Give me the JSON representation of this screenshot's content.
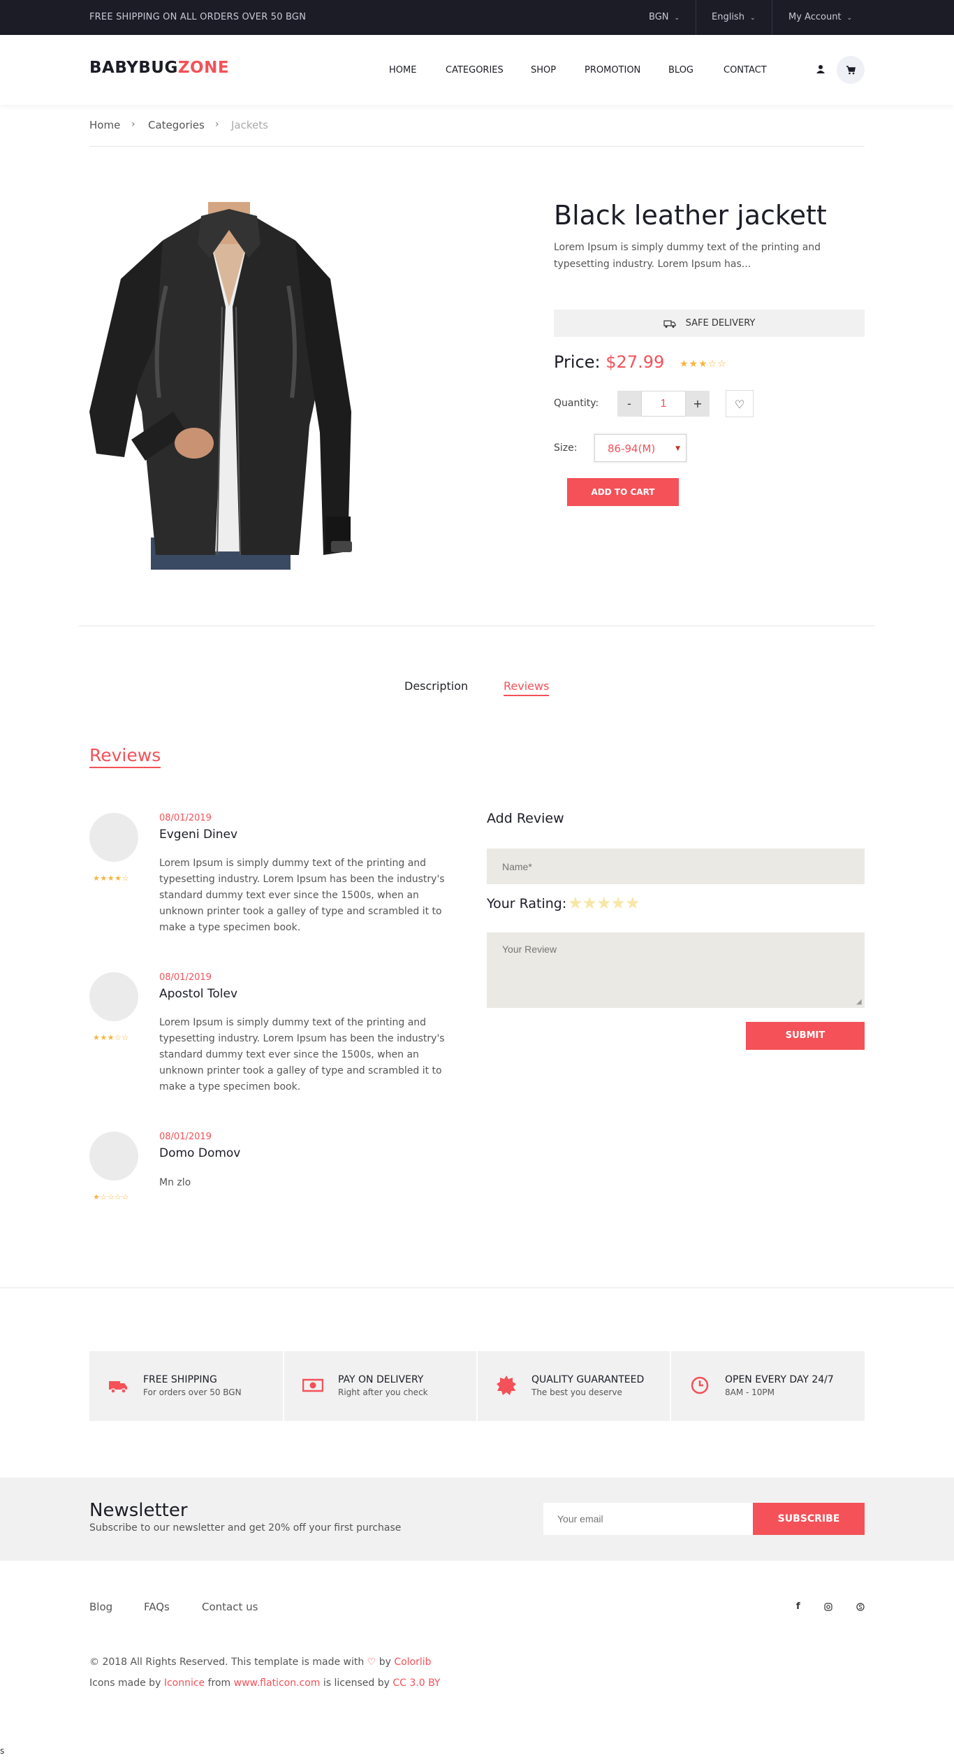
{
  "topbar": {
    "shipping_text": "FREE SHIPPING ON ALL ORDERS OVER 50 BGN",
    "currency": "BGN",
    "language": "English",
    "account": "My Account"
  },
  "header": {
    "logo_part1": "BABYBUG",
    "logo_part2": "ZONE",
    "nav": [
      "HOME",
      "CATEGORIES",
      "SHOP",
      "PROMOTION",
      "BLOG",
      "CONTACT"
    ]
  },
  "breadcrumb": [
    "Home",
    "Categories",
    "Jackets"
  ],
  "product": {
    "title": "Black leather jackett",
    "description": "Lorem Ipsum is simply dummy text of the printing and typesetting industry. Lorem Ipsum has...",
    "safe_delivery": "SAFE DELIVERY",
    "price_label": "Price:",
    "price": "$27.99",
    "rating_stars": "★★★☆☆",
    "quantity_label": "Quantity:",
    "quantity_value": "1",
    "minus": "-",
    "plus": "+",
    "size_label": "Size:",
    "size_value": "86-94(M)",
    "add_to_cart": "ADD TO CART"
  },
  "tabs": {
    "description": "Description",
    "reviews": "Reviews"
  },
  "reviews_heading": "Reviews",
  "reviews": [
    {
      "date": "08/01/2019",
      "name": "Evgeni Dinev",
      "stars": "★★★★☆",
      "text": "Lorem Ipsum is simply dummy text of the printing and typesetting industry. Lorem Ipsum has been the industry's standard dummy text ever since the 1500s, when an unknown printer took a galley of type and scrambled it to make a type specimen book."
    },
    {
      "date": "08/01/2019",
      "name": "Apostol Tolev",
      "stars": "★★★☆☆",
      "text": "Lorem Ipsum is simply dummy text of the printing and typesetting industry. Lorem Ipsum has been the industry's standard dummy text ever since the 1500s, when an unknown printer took a galley of type and scrambled it to make a type specimen book."
    },
    {
      "date": "08/01/2019",
      "name": "Domo Domov",
      "stars": "★☆☆☆☆",
      "text": "Mn zlo"
    }
  ],
  "add_review": {
    "heading": "Add Review",
    "name_placeholder": "Name*",
    "rating_label": "Your Rating:",
    "rating_stars": "★★★★★",
    "review_placeholder": "Your Review",
    "submit": "SUBMIT"
  },
  "features": [
    {
      "title": "FREE SHIPPING",
      "subtitle": "For orders over 50 BGN",
      "icon": "truck-icon"
    },
    {
      "title": "PAY ON DELIVERY",
      "subtitle": "Right after you check",
      "icon": "money-icon"
    },
    {
      "title": "QUALITY GUARANTEED",
      "subtitle": "The best you deserve",
      "icon": "badge-icon"
    },
    {
      "title": "OPEN EVERY DAY 24/7",
      "subtitle": "8AM - 10PM",
      "icon": "clock-icon"
    }
  ],
  "newsletter": {
    "title": "Newsletter",
    "subtitle": "Subscribe to our newsletter and get 20% off your first purchase",
    "email_placeholder": "Your email",
    "button": "SUBSCRIBE"
  },
  "footer": {
    "links": [
      "Blog",
      "FAQs",
      "Contact us"
    ],
    "social": [
      "f",
      "instagram-icon",
      "skype-icon"
    ],
    "copyright_pre": "© 2018 All Rights Reserved. This template is made with",
    "copyright_by": "by",
    "copyright_link": "Colorlib",
    "icons_pre": "Icons made by",
    "icons_author": "Iconnice",
    "icons_from": "from",
    "icons_site": "www.flaticon.com",
    "icons_licensed": "is licensed by",
    "icons_license": "CC 3.0 BY"
  },
  "corner_text": "s",
  "colors": {
    "accent": "#f45158",
    "topbar": "#1b1c26",
    "star": "#f8b53b"
  }
}
